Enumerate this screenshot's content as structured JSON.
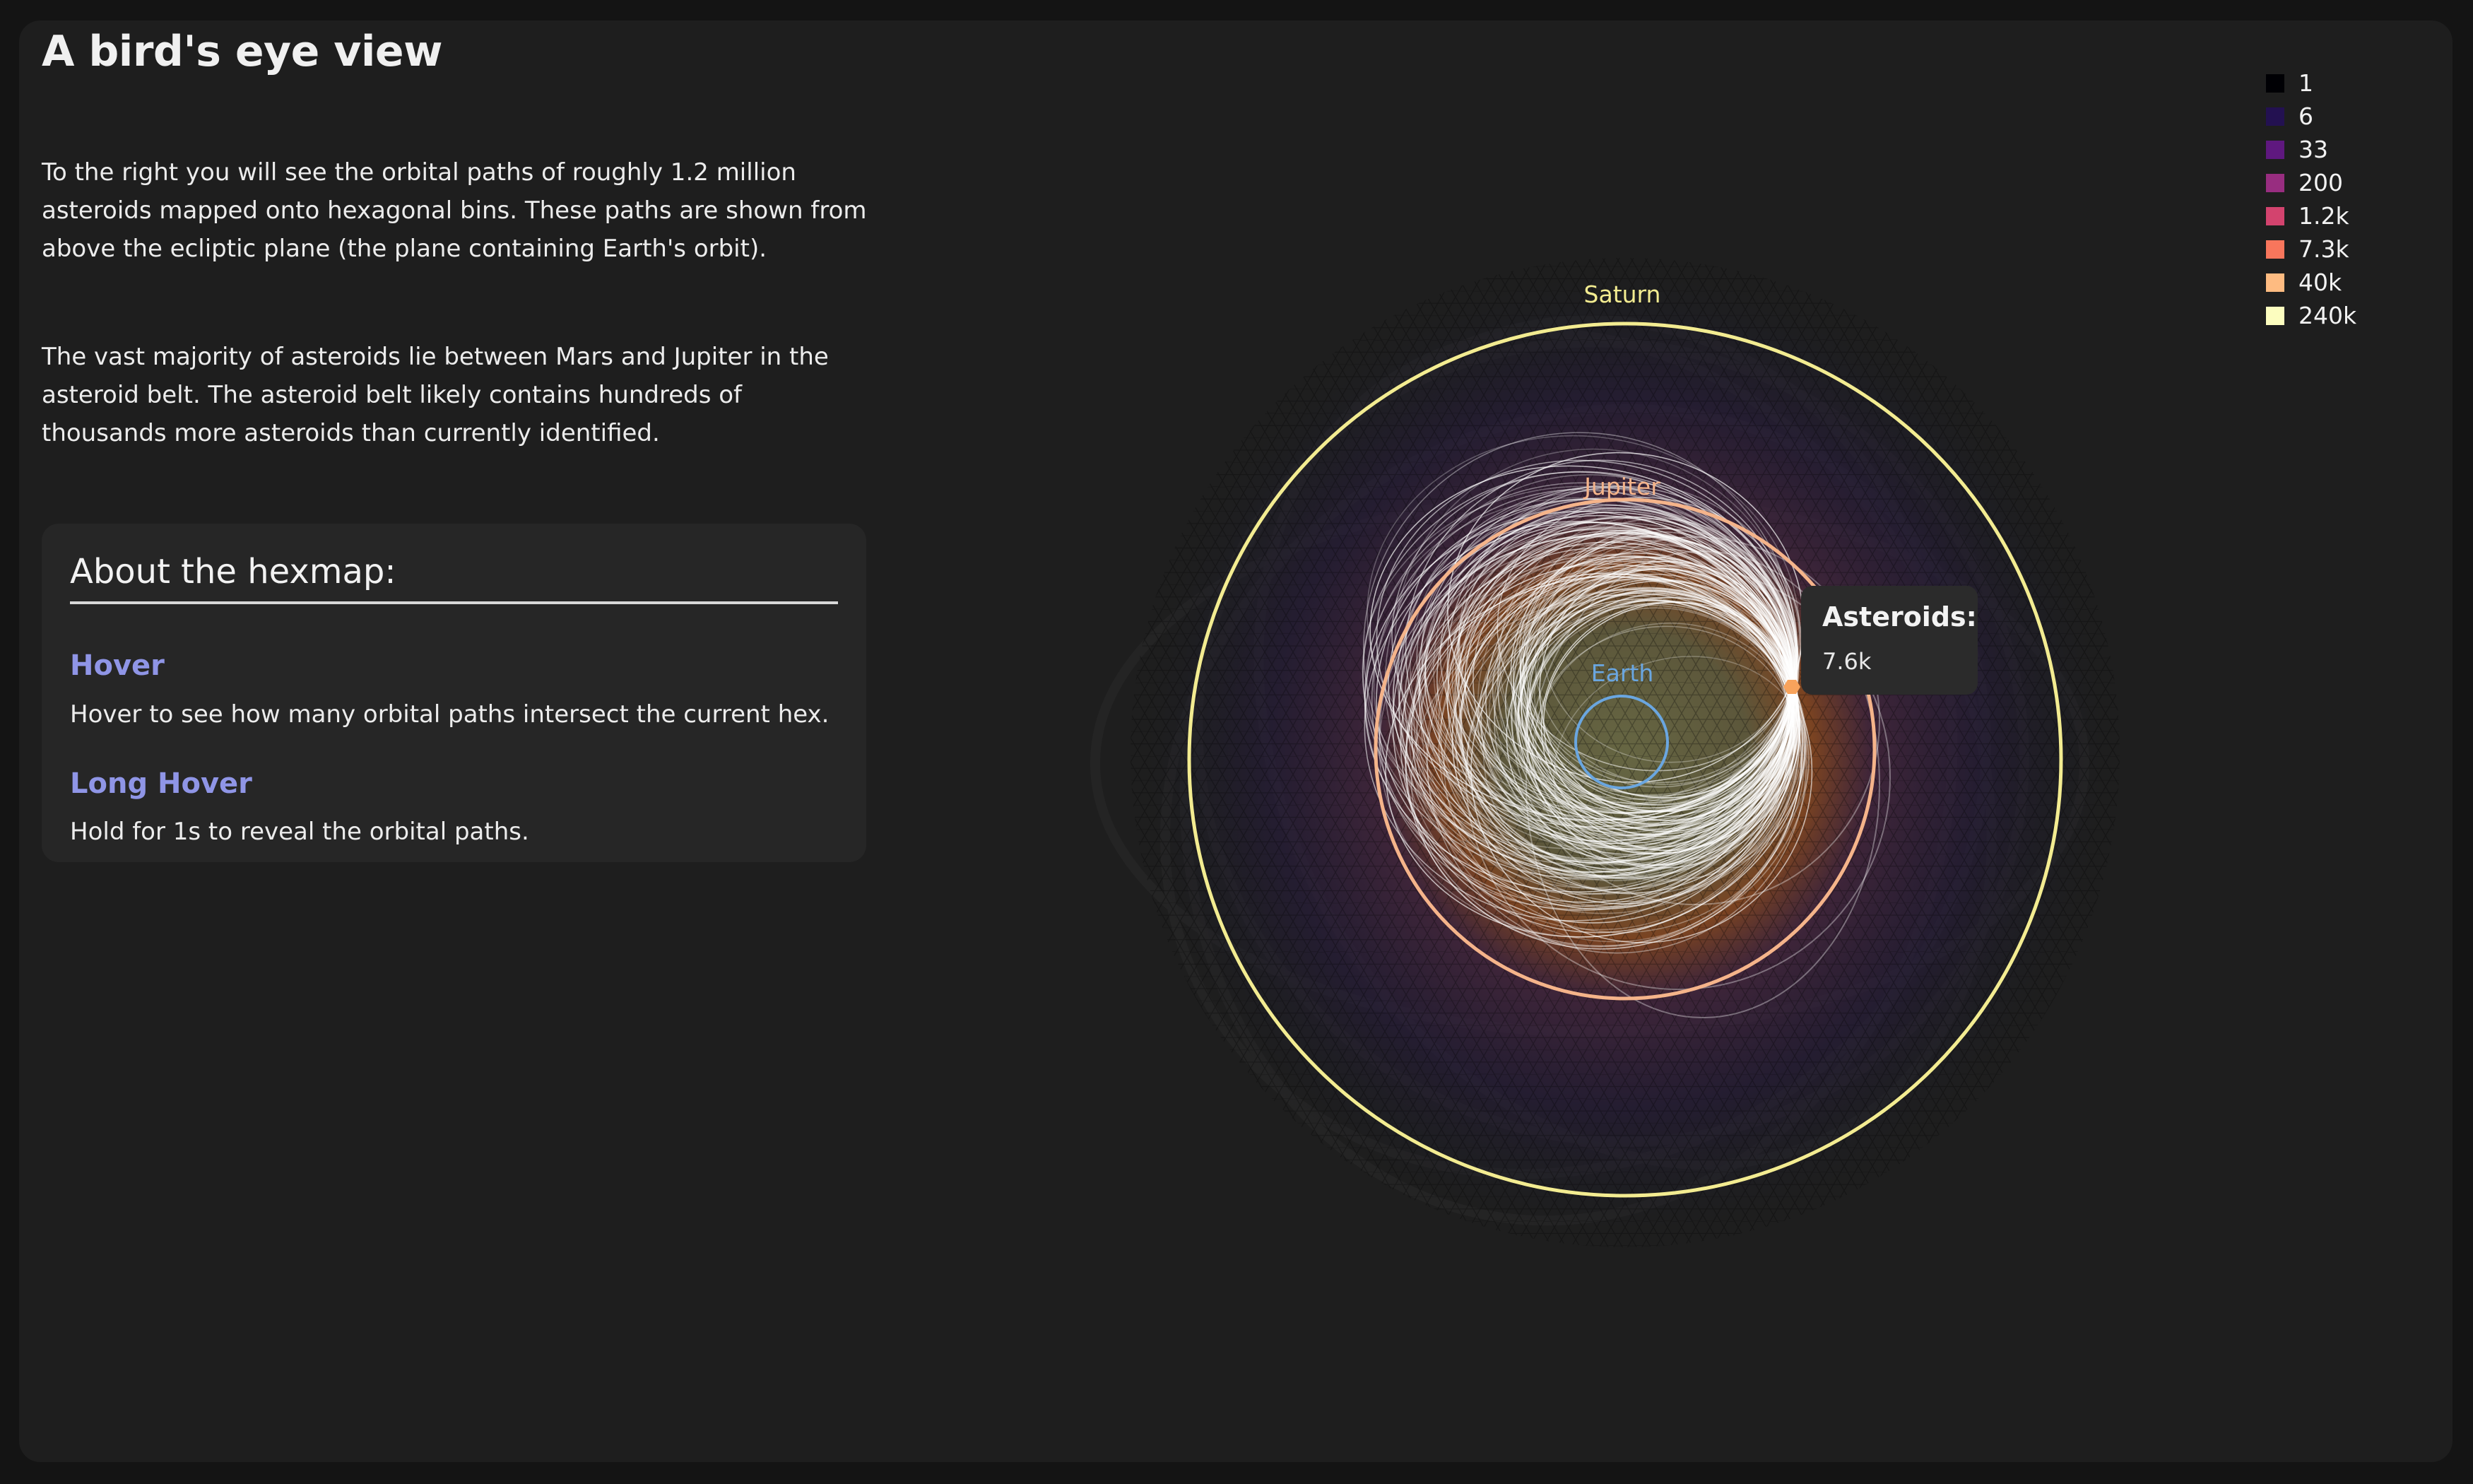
{
  "page": {
    "title": "A bird's eye view",
    "intro": "To the right you will see the orbital paths of roughly 1.2 million asteroids mapped onto hexagonal bins. These paths are shown from above the ecliptic plane (the plane containing Earth's orbit).",
    "belt": "The vast majority of asteroids lie between Mars and Jupiter in the asteroid belt. The asteroid belt likely contains hundreds of thousands more asteroids than currently identified."
  },
  "about": {
    "title": "About the hexmap:",
    "hover_title": "Hover",
    "hover_text": "Hover to see how many orbital paths intersect the current hex.",
    "long_hover_title": "Long Hover",
    "long_hover_text": "Hold for 1s to reveal the orbital paths."
  },
  "orbits": [
    {
      "name": "Saturn",
      "color": "#f3ec91"
    },
    {
      "name": "Jupiter",
      "color": "#f5b48a"
    },
    {
      "name": "Earth",
      "color": "#6aa6e0"
    }
  ],
  "legend": [
    {
      "label": "1",
      "color": "#000004"
    },
    {
      "label": "6",
      "color": "#231151"
    },
    {
      "label": "33",
      "color": "#5f187f"
    },
    {
      "label": "200",
      "color": "#982d80"
    },
    {
      "label": "1.2k",
      "color": "#d3436e"
    },
    {
      "label": "7.3k",
      "color": "#f8765c"
    },
    {
      "label": "40k",
      "color": "#febb81"
    },
    {
      "label": "240k",
      "color": "#fcfdbf"
    }
  ],
  "tooltip": {
    "title": "Asteroids:",
    "value": "7.6k"
  }
}
